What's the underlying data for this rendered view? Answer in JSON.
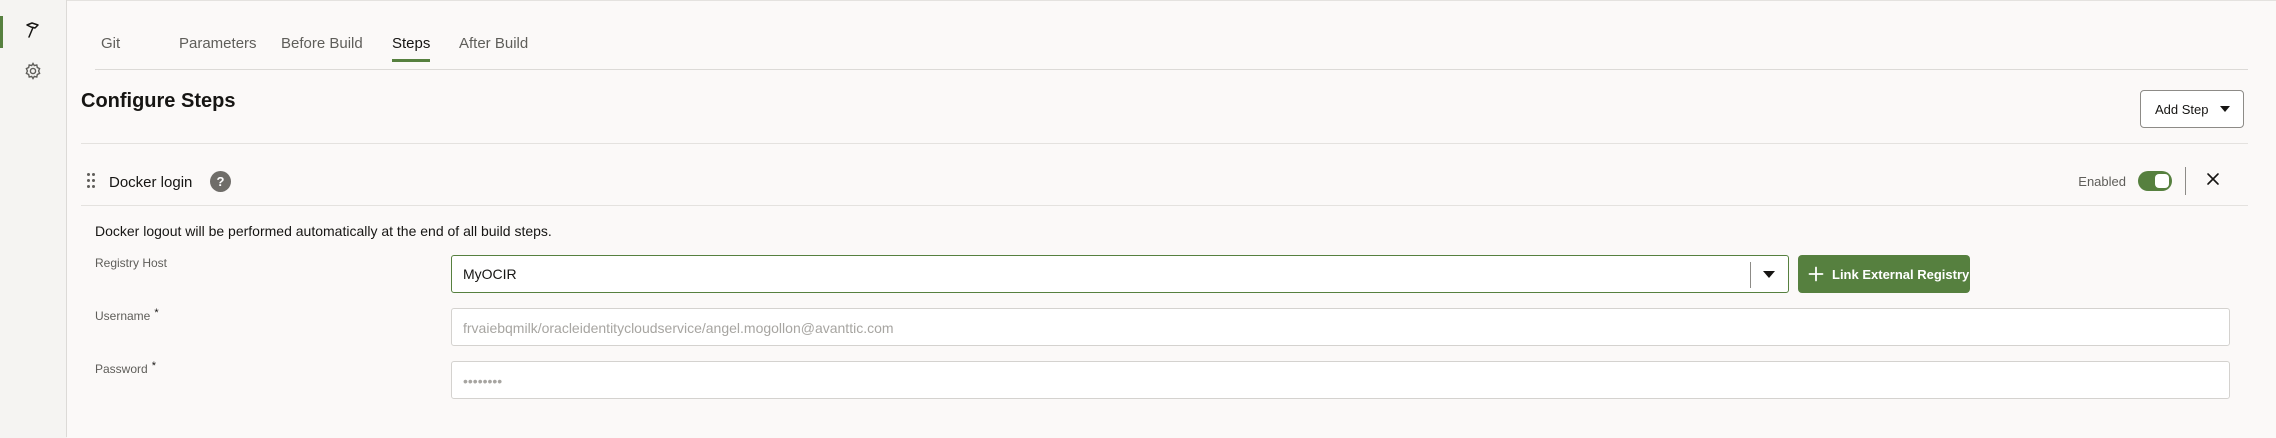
{
  "rail": {
    "items": [
      {
        "icon": "hammer-icon",
        "active": true
      },
      {
        "icon": "gear-icon",
        "active": false
      }
    ]
  },
  "tabs": [
    {
      "label": "Git",
      "active": false
    },
    {
      "label": "Parameters",
      "active": false
    },
    {
      "label": "Before Build",
      "active": false
    },
    {
      "label": "Steps",
      "active": true
    },
    {
      "label": "After Build",
      "active": false
    }
  ],
  "page": {
    "title": "Configure Steps",
    "add_step_label": "Add Step"
  },
  "step": {
    "title": "Docker login",
    "help_glyph": "?",
    "enabled_label": "Enabled",
    "enabled": true,
    "info": "Docker logout will be performed automatically at the end of all build steps.",
    "registry_host": {
      "label": "Registry Host",
      "value": "MyOCIR"
    },
    "link_button_label": "Link External Registry",
    "username": {
      "label": "Username",
      "required_mark": "*",
      "value": "frvaiebqmilk/oracleidentitycloudservice/angel.mogollon@avanttic.com"
    },
    "password": {
      "label": "Password",
      "required_mark": "*",
      "value": "••••••••"
    }
  },
  "colors": {
    "accent": "#56803f",
    "background": "#fbf9f8",
    "rail_background": "#f5f4f2"
  }
}
